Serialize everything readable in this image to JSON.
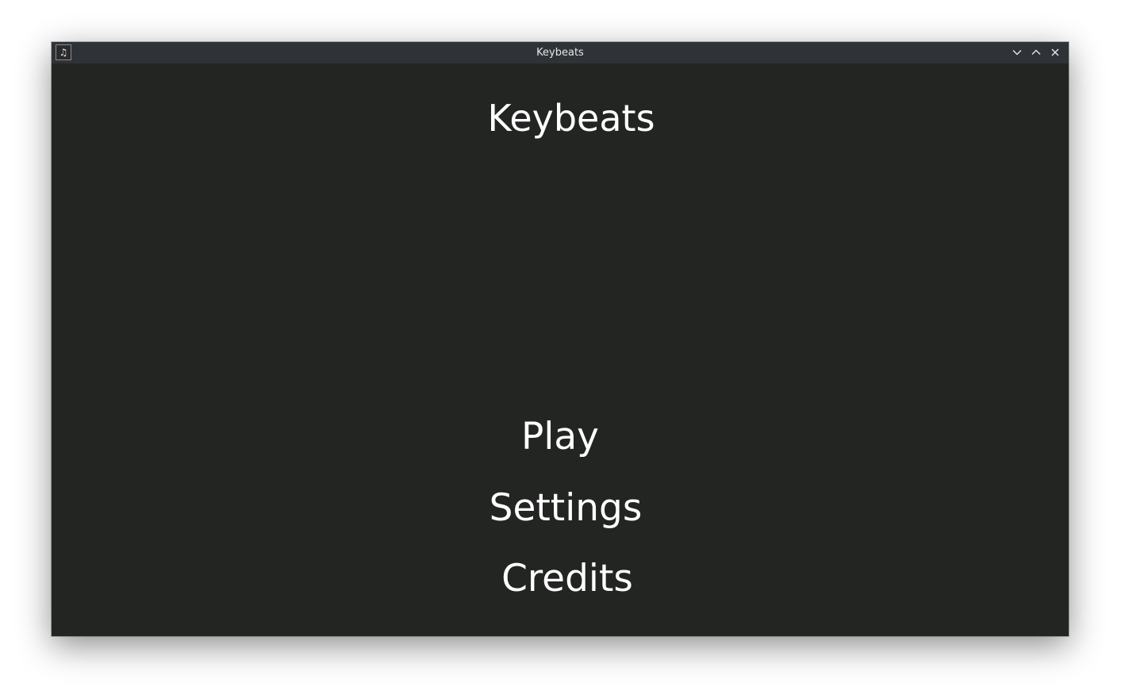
{
  "window": {
    "title": "Keybeats",
    "icon": "music-note-icon",
    "controls": {
      "minimize_icon": "chevron-down-icon",
      "maximize_icon": "chevron-up-icon",
      "close_icon": "close-icon"
    }
  },
  "game": {
    "title": "Keybeats",
    "menu": [
      {
        "label": "Play"
      },
      {
        "label": "Settings"
      },
      {
        "label": "Credits"
      }
    ]
  },
  "colors": {
    "background": "#232523",
    "titlebar": "#2f3337",
    "text": "#ffffff"
  }
}
